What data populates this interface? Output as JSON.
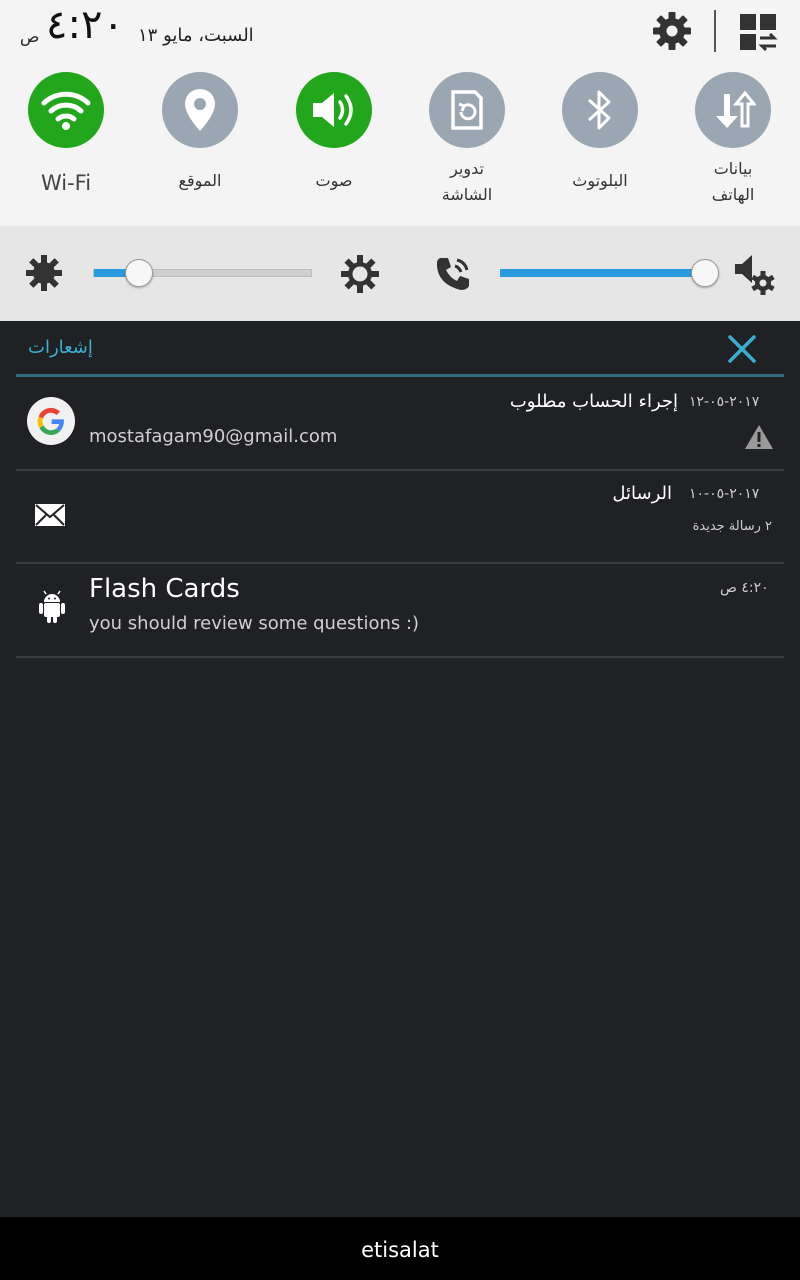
{
  "status": {
    "ampm": "ص",
    "time": "٤:٢٠",
    "date": "السبت، مايو ١٣"
  },
  "quick_toggles": [
    {
      "label": "Wi-Fi",
      "icon": "wifi-icon",
      "state": "on"
    },
    {
      "label": "الموقع",
      "icon": "location-pin-icon",
      "state": "off"
    },
    {
      "label": "صوت",
      "icon": "speaker-icon",
      "state": "on"
    },
    {
      "label_line1": "تدوير",
      "label_line2": "الشاشة",
      "icon": "rotate-screen-icon",
      "state": "off"
    },
    {
      "label": "البلوتوث",
      "icon": "bluetooth-icon",
      "state": "off"
    },
    {
      "label_line1": "بيانات",
      "label_line2": "الهاتف",
      "icon": "mobile-data-icon",
      "state": "off"
    }
  ],
  "sliders": {
    "brightness_level": 0.21,
    "volume_level": 0.99
  },
  "notifications": {
    "header": "إشعارات",
    "items": [
      {
        "title": "إجراء الحساب مطلوب",
        "date": "٢٠١٧-٠٥-١٢",
        "subtitle": "mostafagam90@gmail.com",
        "icon": "google-icon"
      },
      {
        "title": "الرسائل",
        "date": "٢٠١٧-٠٥-١٠",
        "subtitle": "٢ رسالة جديدة",
        "icon": "envelope-icon"
      },
      {
        "title": "Flash Cards",
        "date": "٤:٢٠ ص",
        "subtitle": "you should review some questions :)",
        "icon": "android-icon"
      }
    ]
  },
  "carrier": "etisalat",
  "colors": {
    "toggle_on": "#22a61c",
    "toggle_off": "#9aa6b2",
    "accent": "#3ab0d0",
    "slider_fill": "#2b9be0"
  }
}
